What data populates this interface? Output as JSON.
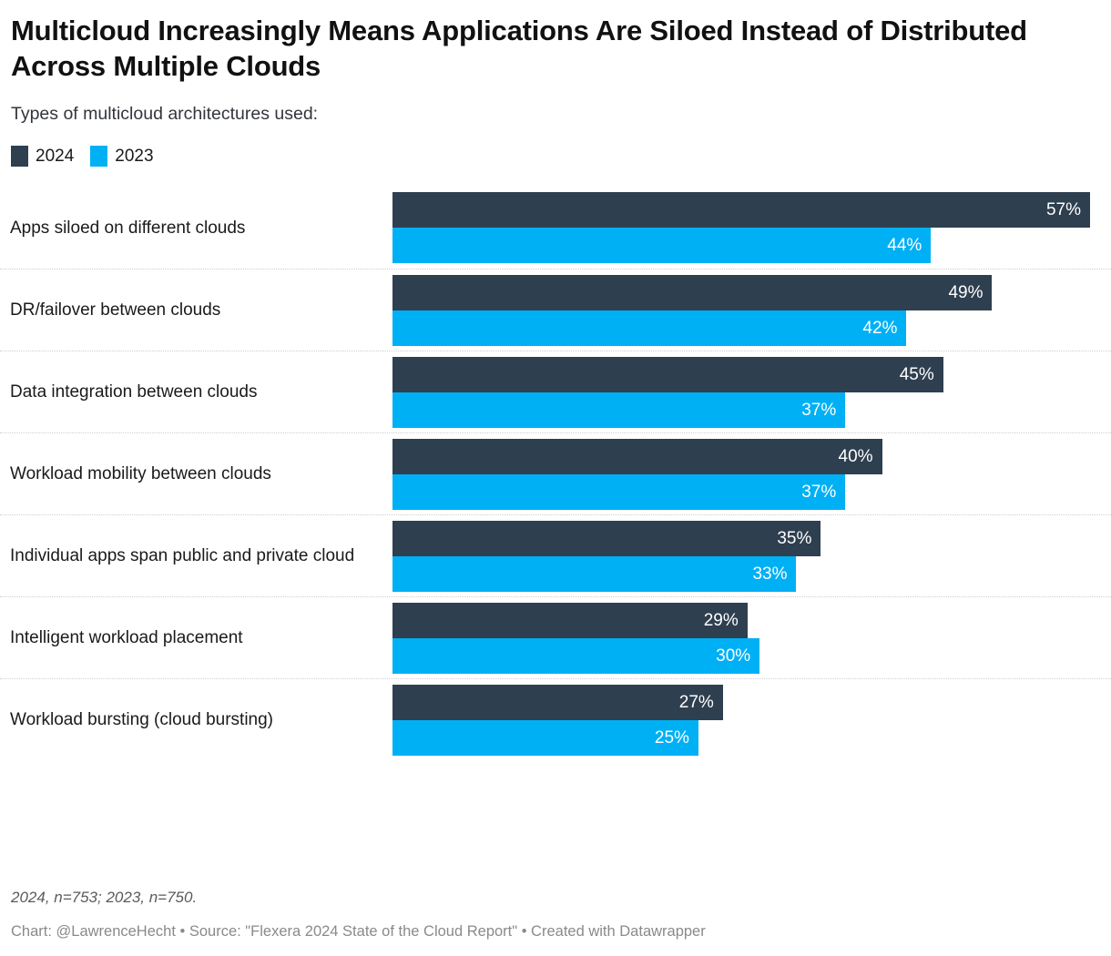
{
  "header": {
    "title": "Multicloud Increasingly Means Applications Are Siloed Instead of Distributed Across Multiple Clouds",
    "subtitle": "Types of multicloud architectures used:"
  },
  "legend": {
    "items": [
      {
        "label": "2024",
        "color": "#2e3f50"
      },
      {
        "label": "2023",
        "color": "#00b0f5"
      }
    ]
  },
  "footer": {
    "note": "2024, n=753; 2023, n=750.",
    "credit": "Chart: @LawrenceHecht • Source: \"Flexera 2024 State of the Cloud Report\" • Created with Datawrapper"
  },
  "chart_data": {
    "type": "bar",
    "orientation": "horizontal",
    "title": "Multicloud Increasingly Means Applications Are Siloed Instead of Distributed Across Multiple Clouds",
    "subtitle": "Types of multicloud architectures used:",
    "xlabel": "",
    "ylabel": "",
    "xlim": [
      0,
      57
    ],
    "grid": false,
    "legend_position": "top-left",
    "value_suffix": "%",
    "categories": [
      "Apps siloed on different clouds",
      "DR/failover between clouds",
      "Data integration between clouds",
      "Workload mobility between clouds",
      "Individual apps span public and private cloud",
      "Intelligent workload placement",
      "Workload bursting (cloud bursting)"
    ],
    "series": [
      {
        "name": "2024",
        "color": "#2e3f50",
        "values": [
          57,
          49,
          45,
          40,
          35,
          29,
          27
        ],
        "labels": [
          "57%",
          "49%",
          "45%",
          "40%",
          "35%",
          "29%",
          "27%"
        ]
      },
      {
        "name": "2023",
        "color": "#00b0f5",
        "values": [
          44,
          42,
          37,
          37,
          33,
          30,
          25
        ],
        "labels": [
          "44%",
          "42%",
          "37%",
          "37%",
          "33%",
          "30%",
          "25%"
        ]
      }
    ],
    "note": "2024, n=753; 2023, n=750.",
    "source": "Chart: @LawrenceHecht • Source: \"Flexera 2024 State of the Cloud Report\" • Created with Datawrapper"
  }
}
